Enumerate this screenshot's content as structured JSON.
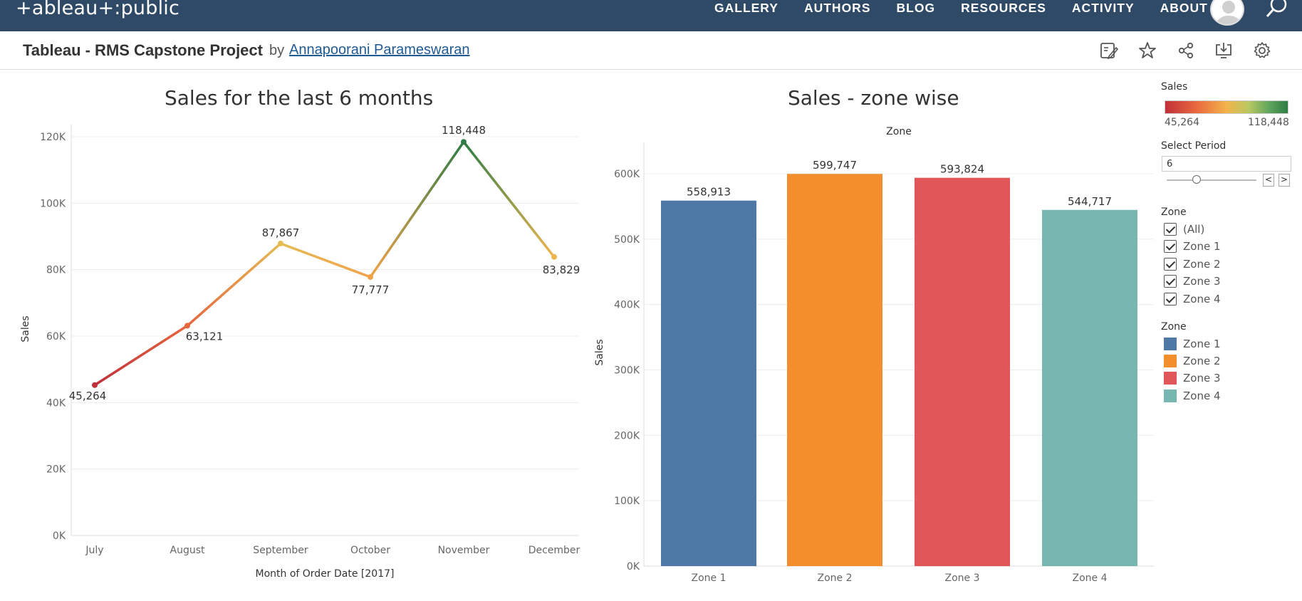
{
  "app": {
    "logo": "+ableau+:public",
    "nav": [
      "GALLERY",
      "AUTHORS",
      "BLOG",
      "RESOURCES",
      "ACTIVITY",
      "ABOUT"
    ]
  },
  "viz": {
    "title": "Tableau - RMS Capstone Project",
    "by": "by",
    "author": "Annapoorani Parameswaran"
  },
  "toolbar_icons": [
    "edit-icon",
    "star-icon",
    "share-icon",
    "download-icon",
    "settings-icon"
  ],
  "legend_panel": {
    "sales_title": "Sales",
    "sales_min": "45,264",
    "sales_max": "118,448",
    "period_title": "Select Period",
    "period_value": "6",
    "period_prev": "<",
    "period_next": ">",
    "zone_filter_title": "Zone",
    "zone_filter": [
      "(All)",
      "Zone 1",
      "Zone 2",
      "Zone 3",
      "Zone 4"
    ],
    "zone_legend_title": "Zone",
    "zone_legend": [
      {
        "label": "Zone 1",
        "color": "#4e79a7"
      },
      {
        "label": "Zone 2",
        "color": "#f28e2b"
      },
      {
        "label": "Zone 3",
        "color": "#e15759"
      },
      {
        "label": "Zone 4",
        "color": "#76b7b2"
      }
    ]
  },
  "chart_data": [
    {
      "type": "line",
      "title": "Sales for the last 6 months",
      "xlabel": "Month of Order Date [2017]",
      "ylabel": "Sales",
      "categories": [
        "July",
        "August",
        "September",
        "October",
        "November",
        "December"
      ],
      "values": [
        45264,
        63121,
        87867,
        77777,
        118448,
        83829
      ],
      "value_labels": [
        "45,264",
        "63,121",
        "87,867",
        "77,777",
        "118,448",
        "83,829"
      ],
      "ylim": [
        0,
        120000
      ],
      "yticks": [
        "0K",
        "20K",
        "40K",
        "60K",
        "80K",
        "100K",
        "120K"
      ],
      "color_scale": [
        "#c0303a",
        "#e8673d",
        "#f3b34c",
        "#c7cb63",
        "#2f7d45"
      ],
      "grid": true
    },
    {
      "type": "bar",
      "title": "Sales - zone wise",
      "xheader": "Zone",
      "ylabel": "Sales",
      "categories": [
        "Zone 1",
        "Zone 2",
        "Zone 3",
        "Zone 4"
      ],
      "values": [
        558913,
        599747,
        593824,
        544717
      ],
      "value_labels": [
        "558,913",
        "599,747",
        "593,824",
        "544,717"
      ],
      "colors": [
        "#4e79a7",
        "#f28e2b",
        "#e15759",
        "#76b7b2"
      ],
      "ylim": [
        0,
        600000
      ],
      "yticks": [
        "0K",
        "100K",
        "200K",
        "300K",
        "400K",
        "500K",
        "600K"
      ],
      "grid": true
    }
  ]
}
